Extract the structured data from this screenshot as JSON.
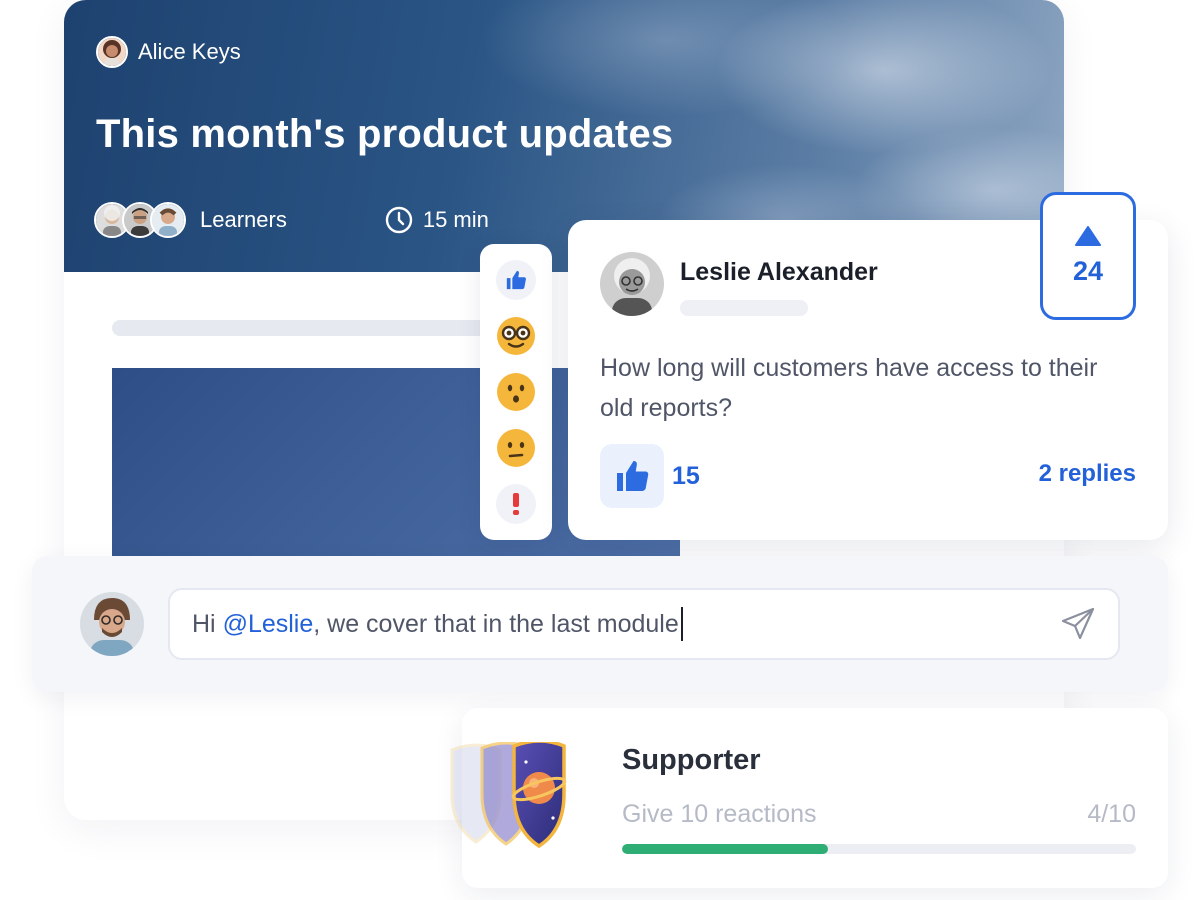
{
  "course": {
    "author_name": "Alice Keys",
    "title": "This month's product updates",
    "audience_label": "Learners",
    "duration": "15 min"
  },
  "reactions": [
    {
      "icon": "thumbs-up-icon"
    },
    {
      "icon": "nerd-face-icon"
    },
    {
      "icon": "surprised-face-icon"
    },
    {
      "icon": "confused-face-icon"
    },
    {
      "icon": "exclamation-icon"
    }
  ],
  "comment": {
    "author": "Leslie Alexander",
    "text": "How long will customers have access to their old reports?",
    "likes": "15",
    "replies": "2 replies",
    "upvotes": "24"
  },
  "composer": {
    "prefix": "Hi ",
    "mention": "@Leslie",
    "suffix": ", we cover that in the last module"
  },
  "badge": {
    "title": "Supporter",
    "task": "Give 10 reactions",
    "progress_text": "4/10",
    "progress_fraction": 0.4
  },
  "colors": {
    "accent": "#2361d9",
    "progress": "#2eae74"
  }
}
